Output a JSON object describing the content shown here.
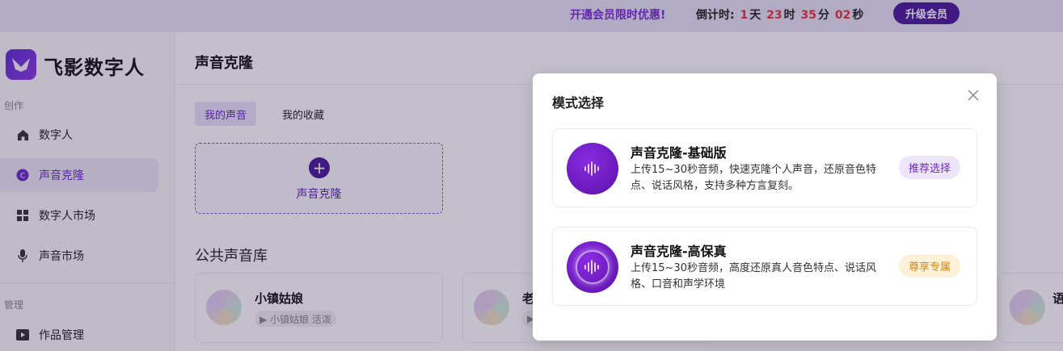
{
  "promo": {
    "text": "开通会员限时优惠!",
    "countdown_label": "倒计时:",
    "days": "1",
    "days_unit": "天",
    "hours": "23",
    "hours_unit": "时",
    "minutes": "35",
    "minutes_unit": "分",
    "seconds": "02",
    "seconds_unit": "秒",
    "upgrade_label": "升级会员"
  },
  "sidebar": {
    "brand": "飞影数字人",
    "group_create": "创作",
    "group_manage": "管理",
    "items": [
      {
        "label": "数字人",
        "icon": "home-icon"
      },
      {
        "label": "声音克隆",
        "icon": "clone-icon"
      },
      {
        "label": "数字人市场",
        "icon": "grid-icon"
      },
      {
        "label": "声音市场",
        "icon": "microphone-icon"
      },
      {
        "label": "作品管理",
        "icon": "video-icon"
      }
    ]
  },
  "main": {
    "title": "声音克隆",
    "tabs": [
      "我的声音",
      "我的收藏"
    ],
    "clone_label": "声音克隆",
    "library_title": "公共声音库",
    "voices": [
      {
        "name": "小镇姑娘",
        "tag": "▶ 小镇姑娘 活泼"
      },
      {
        "name": "老",
        "tag": "▶"
      },
      {
        "name": "语",
        "tag": ""
      }
    ]
  },
  "modal": {
    "title": "模式选择",
    "modes": [
      {
        "title": "声音克隆-基础版",
        "desc": "上传15~30秒音频，快速克隆个人声音，还原音色特点、说话风格，支持多种方言复刻。",
        "badge": "推荐选择"
      },
      {
        "title": "声音克隆-高保真",
        "desc": "上传15~30秒音频，高度还原真人音色特点、说话风格、口音和声学环境",
        "badge": "尊享专属"
      }
    ]
  },
  "colors": {
    "accent": "#6b2ac9",
    "dark_purple": "#4a1a9a",
    "countdown_number": "#e8343b",
    "vip_badge": "#d7851b"
  }
}
